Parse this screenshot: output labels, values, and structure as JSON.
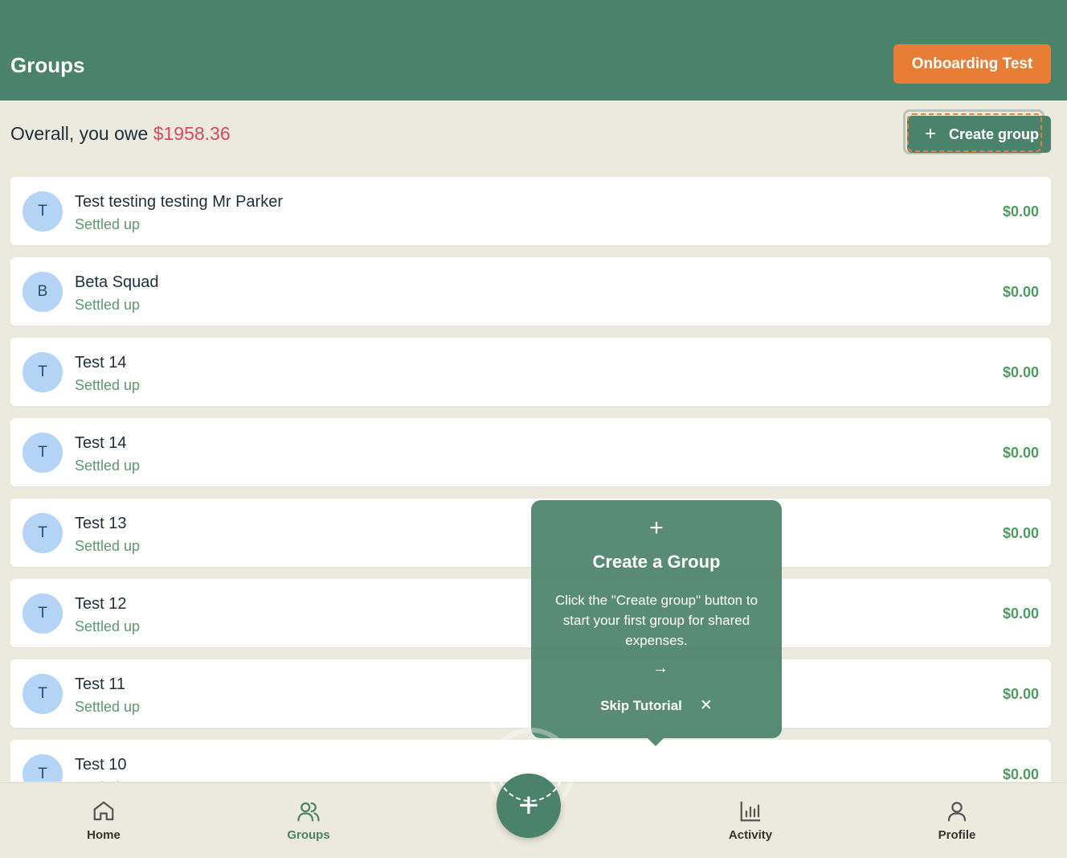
{
  "header": {
    "title": "Groups",
    "onboarding_label": "Onboarding Test"
  },
  "summary": {
    "prefix": "Overall, you owe",
    "amount": "$1958.36"
  },
  "create_group": {
    "icon": "plus-icon",
    "label": "Create group"
  },
  "groups": [
    {
      "initial": "T",
      "name": "Test testing testing Mr Parker",
      "status": "Settled up",
      "balance": "$0.00"
    },
    {
      "initial": "B",
      "name": "Beta Squad",
      "status": "Settled up",
      "balance": "$0.00"
    },
    {
      "initial": "T",
      "name": "Test 14",
      "status": "Settled up",
      "balance": "$0.00"
    },
    {
      "initial": "T",
      "name": "Test 14",
      "status": "Settled up",
      "balance": "$0.00"
    },
    {
      "initial": "T",
      "name": "Test 13",
      "status": "Settled up",
      "balance": "$0.00"
    },
    {
      "initial": "T",
      "name": "Test 12",
      "status": "Settled up",
      "balance": "$0.00"
    },
    {
      "initial": "T",
      "name": "Test 11",
      "status": "Settled up",
      "balance": "$0.00"
    },
    {
      "initial": "T",
      "name": "Test 10",
      "status": "Settled up",
      "balance": "$0.00"
    }
  ],
  "tooltip": {
    "icon": "plus-icon",
    "title": "Create a Group",
    "body": "Click the \"Create group\" button to start your first group for shared expenses.",
    "next_icon": "arrow-right-icon",
    "skip_label": "Skip Tutorial",
    "close_icon": "close-icon"
  },
  "nav": {
    "home": "Home",
    "groups": "Groups",
    "activity": "Activity",
    "profile": "Profile",
    "active": "groups",
    "fab_icon": "plus-icon"
  },
  "colors": {
    "brand": "#4a826b",
    "accent": "#e87d35",
    "owe": "#d9485f",
    "settled": "#5a9a6c",
    "avatar": "#b3d4f5",
    "background": "#ece9de"
  }
}
